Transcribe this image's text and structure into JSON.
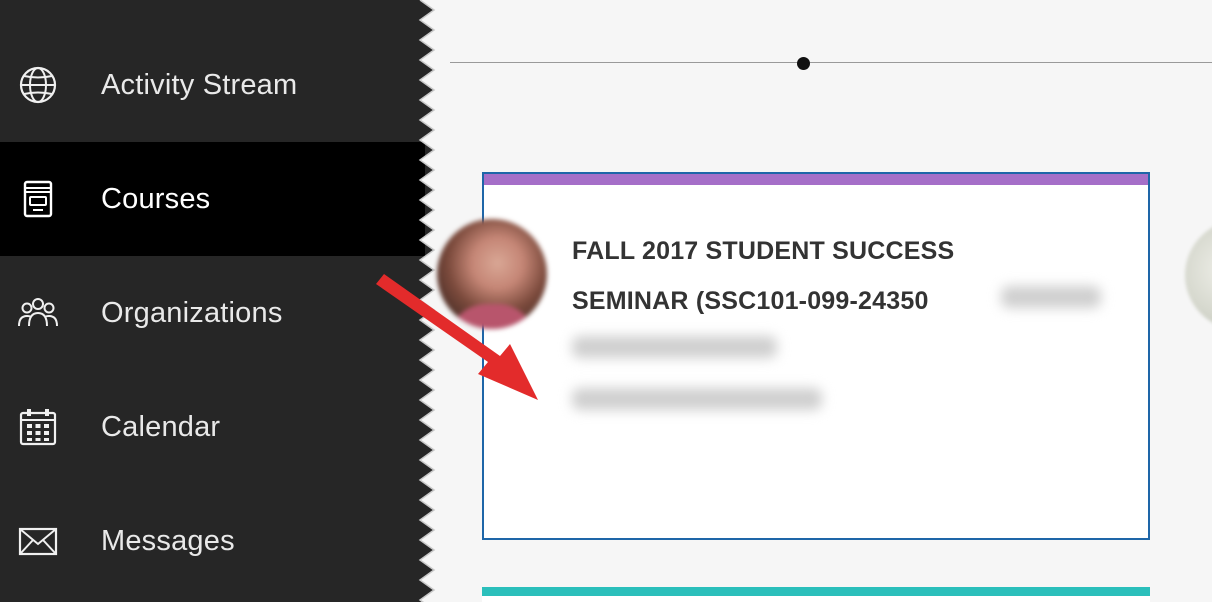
{
  "sidebar": {
    "items": [
      {
        "label": "Activity Stream",
        "icon": "globe-icon",
        "active": false
      },
      {
        "label": "Courses",
        "icon": "book-icon",
        "active": true
      },
      {
        "label": "Organizations",
        "icon": "people-icon",
        "active": false
      },
      {
        "label": "Calendar",
        "icon": "calendar-icon",
        "active": false
      },
      {
        "label": "Messages",
        "icon": "envelope-icon",
        "active": false
      }
    ]
  },
  "course_card": {
    "title_line1": "FALL 2017 STUDENT SUCCESS",
    "title_line2": "SEMINAR (SSC101-099-24350"
  },
  "colors": {
    "sidebar_bg": "#262626",
    "active_bg": "#000000",
    "card_accent": "#a56fc8",
    "card_border": "#1e66a8",
    "next_card_accent": "#2bbfbb",
    "arrow": "#e32b2b"
  }
}
